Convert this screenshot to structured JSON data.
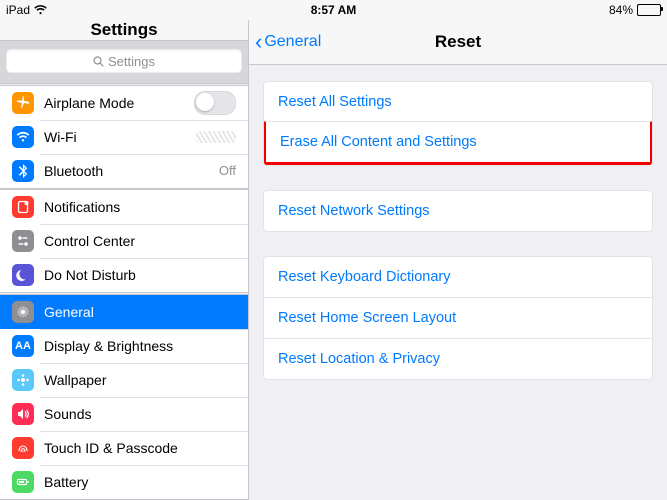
{
  "status": {
    "carrier": "iPad",
    "time": "8:57 AM",
    "battery_pct": "84%"
  },
  "sidebar": {
    "title": "Settings",
    "search_placeholder": "Settings",
    "group1": [
      {
        "key": "airplane",
        "label": "Airplane Mode",
        "icon": "bg-orange",
        "glyph": "plane",
        "accessory": "switch"
      },
      {
        "key": "wifi",
        "label": "Wi-Fi",
        "icon": "bg-blue",
        "glyph": "wifi",
        "accessory": "scribble"
      },
      {
        "key": "bluetooth",
        "label": "Bluetooth",
        "icon": "bg-blue",
        "glyph": "bt",
        "accessory_text": "Off"
      }
    ],
    "group2": [
      {
        "key": "notifications",
        "label": "Notifications",
        "icon": "bg-red",
        "glyph": "bell"
      },
      {
        "key": "controlcenter",
        "label": "Control Center",
        "icon": "bg-gray",
        "glyph": "switches"
      },
      {
        "key": "dnd",
        "label": "Do Not Disturb",
        "icon": "bg-purple",
        "glyph": "moon"
      }
    ],
    "group3": [
      {
        "key": "general",
        "label": "General",
        "icon": "bg-gray",
        "glyph": "gear",
        "selected": true
      },
      {
        "key": "display",
        "label": "Display & Brightness",
        "icon": "bg-bluea",
        "glyph": "aa"
      },
      {
        "key": "wallpaper",
        "label": "Wallpaper",
        "icon": "bg-cyan",
        "glyph": "flower"
      },
      {
        "key": "sounds",
        "label": "Sounds",
        "icon": "bg-pink",
        "glyph": "speaker"
      },
      {
        "key": "touchid",
        "label": "Touch ID & Passcode",
        "icon": "bg-red",
        "glyph": "finger"
      },
      {
        "key": "battery",
        "label": "Battery",
        "icon": "bg-green",
        "glyph": "batt"
      }
    ]
  },
  "detail": {
    "back_label": "General",
    "title": "Reset",
    "group1": [
      {
        "key": "reset_all",
        "label": "Reset All Settings"
      },
      {
        "key": "erase_all",
        "label": "Erase All Content and Settings",
        "highlight": true
      }
    ],
    "group2": [
      {
        "key": "reset_network",
        "label": "Reset Network Settings"
      }
    ],
    "group3": [
      {
        "key": "reset_keyboard",
        "label": "Reset Keyboard Dictionary"
      },
      {
        "key": "reset_home",
        "label": "Reset Home Screen Layout"
      },
      {
        "key": "reset_location",
        "label": "Reset Location & Privacy"
      }
    ]
  }
}
